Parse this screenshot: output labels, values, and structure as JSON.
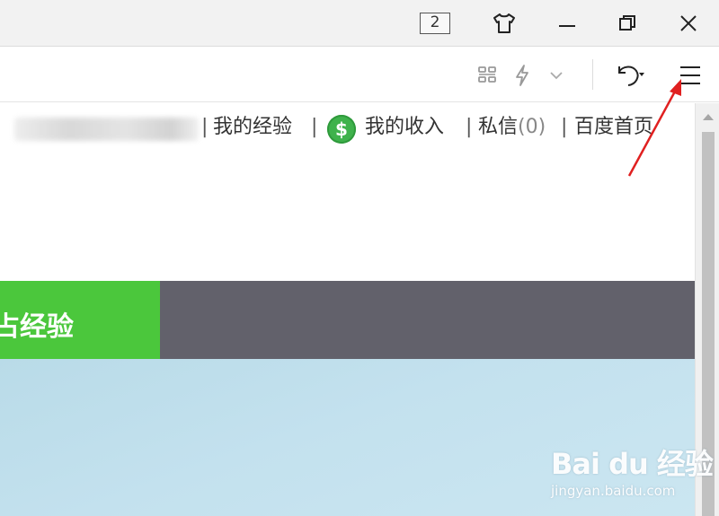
{
  "window": {
    "tab_count": "2"
  },
  "toolbar": {
    "icons": [
      "qr-code-icon",
      "lightning-icon",
      "chevron-down-icon",
      "undo-icon",
      "menu-icon"
    ]
  },
  "userbar": {
    "sep1": "|",
    "my_experience": "我的经验",
    "sep2": "|",
    "coin_symbol": "$",
    "my_income": "我的收入",
    "sep3": "|",
    "messages_label": "私信",
    "messages_count": "(0)",
    "sep4": "|",
    "homepage": "百度首页"
  },
  "nav": {
    "active_label": "占经验"
  },
  "watermark": {
    "logo": "Bai du 经验",
    "url": "jingyan.baidu.com"
  },
  "colors": {
    "accent_green": "#4bc73c",
    "nav_dark": "#62616b",
    "banner_blue": "#c3e1ee",
    "annotation_red": "#e02020"
  }
}
